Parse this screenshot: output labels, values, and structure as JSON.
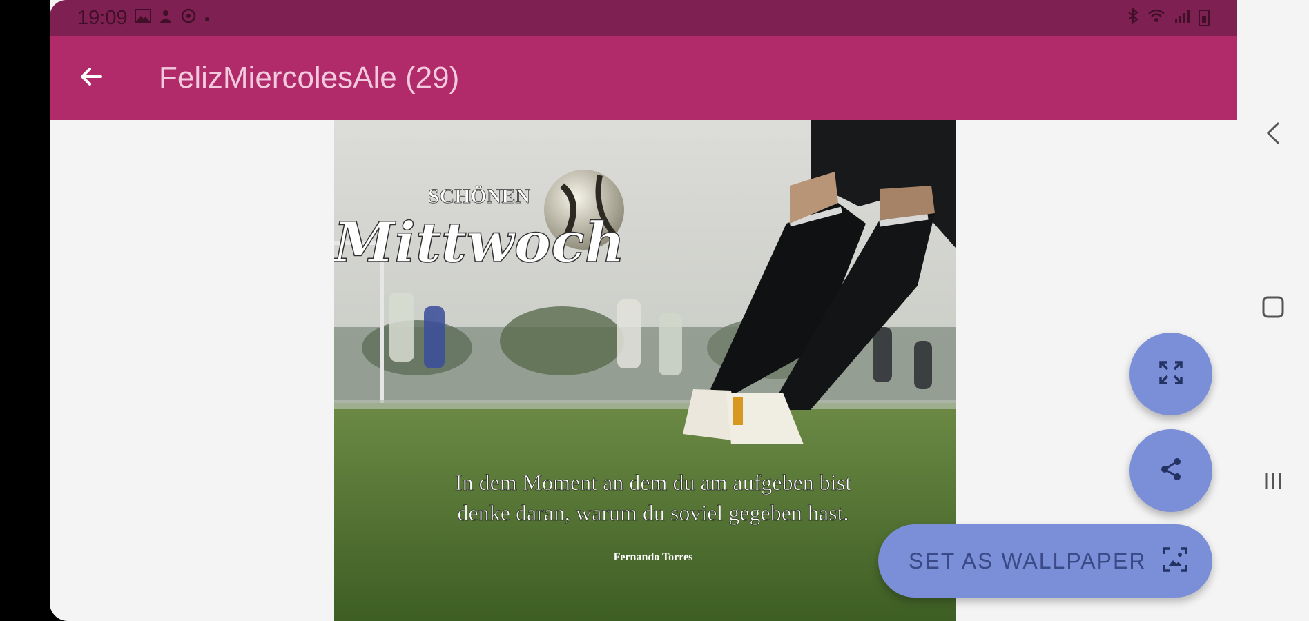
{
  "status_bar": {
    "time": "19:09",
    "left_icons": [
      "gallery-icon",
      "notification-icon",
      "whatsapp-icon",
      "dot-icon"
    ],
    "right_icons": [
      "bluetooth-icon",
      "wifi-icon",
      "signal-icon",
      "battery-icon"
    ]
  },
  "app_bar": {
    "title": "FelizMiercolesAle (29)",
    "back_icon": "arrow-back-icon"
  },
  "image": {
    "headline_small": "SCHÖNEN",
    "headline_script": "Mittwoch",
    "quote_line_1": "In dem Moment an dem du am aufgeben bist",
    "quote_line_2": "denke daran, warum du soviel gegeben hast.",
    "author": "Fernando Torres"
  },
  "actions": {
    "set_wallpaper_label": "SET AS WALLPAPER",
    "fullscreen_icon": "fullscreen-icon",
    "share_icon": "share-icon",
    "wallpaper_icon": "wallpaper-icon"
  },
  "colors": {
    "status_bar": "#7f2052",
    "app_bar": "#b12b6b",
    "fab": "#7b8fd8",
    "background": "#f4f4f4"
  }
}
